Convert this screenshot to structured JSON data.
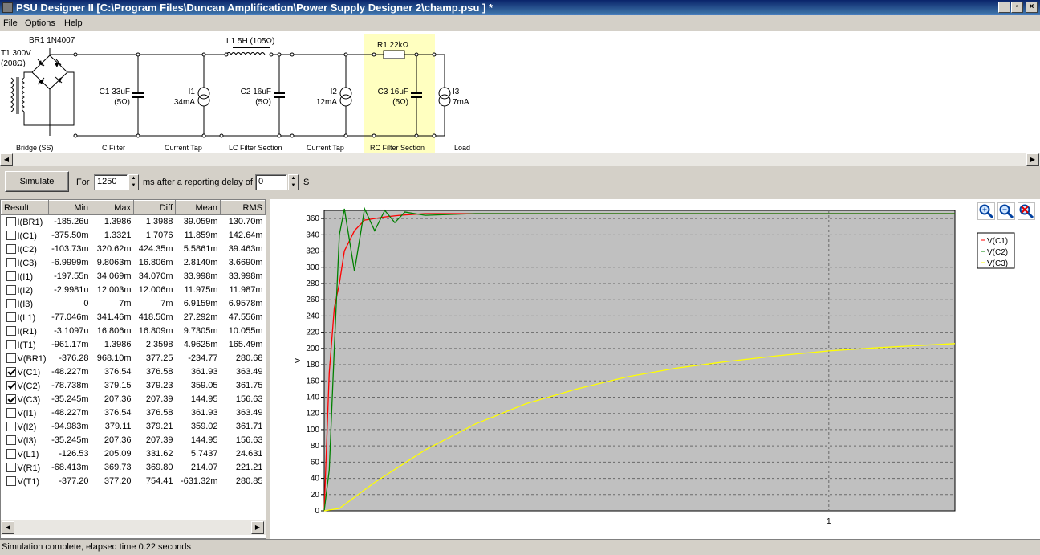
{
  "window": {
    "title": "PSU Designer II  [C:\\Program Files\\Duncan Amplification\\Power Supply Designer 2\\champ.psu ] *"
  },
  "menu": [
    "File",
    "Options",
    "Help"
  ],
  "schematic": {
    "transformer": {
      "name": "T1 300V",
      "detail": "(208Ω)"
    },
    "rectifier": "BR1 1N4007",
    "c1": {
      "name": "C1 33uF",
      "detail": "(5Ω)"
    },
    "i1": {
      "name": "I1",
      "detail": "34mA"
    },
    "l1": "L1 5H (105Ω)",
    "c2": {
      "name": "C2 16uF",
      "detail": "(5Ω)"
    },
    "i2": {
      "name": "I2",
      "detail": "12mA"
    },
    "r1": "R1 22kΩ",
    "c3": {
      "name": "C3 16uF",
      "detail": "(5Ω)"
    },
    "i3": {
      "name": "I3",
      "detail": "7mA"
    },
    "sections": [
      "Bridge (SS)",
      "C Filter",
      "Current Tap",
      "LC Filter Section",
      "Current Tap",
      "RC Filter Section",
      "Load"
    ]
  },
  "sim": {
    "button": "Simulate",
    "for_label": "For",
    "ms_value": "1250",
    "ms_label": "ms  after a reporting delay of",
    "delay_value": "0",
    "unit": "S"
  },
  "table": {
    "headers": [
      "Result",
      "Min",
      "Max",
      "Diff",
      "Mean",
      "RMS"
    ],
    "rows": [
      {
        "name": "I(BR1)",
        "checked": false,
        "v": [
          "-185.26u",
          "1.3986",
          "1.3988",
          "39.059m",
          "130.70m"
        ]
      },
      {
        "name": "I(C1)",
        "checked": false,
        "v": [
          "-375.50m",
          "1.3321",
          "1.7076",
          "11.859m",
          "142.64m"
        ]
      },
      {
        "name": "I(C2)",
        "checked": false,
        "v": [
          "-103.73m",
          "320.62m",
          "424.35m",
          "5.5861m",
          "39.463m"
        ]
      },
      {
        "name": "I(C3)",
        "checked": false,
        "v": [
          "-6.9999m",
          "9.8063m",
          "16.806m",
          "2.8140m",
          "3.6690m"
        ]
      },
      {
        "name": "I(I1)",
        "checked": false,
        "v": [
          "-197.55n",
          "34.069m",
          "34.070m",
          "33.998m",
          "33.998m"
        ]
      },
      {
        "name": "I(I2)",
        "checked": false,
        "v": [
          "-2.9981u",
          "12.003m",
          "12.006m",
          "11.975m",
          "11.987m"
        ]
      },
      {
        "name": "I(I3)",
        "checked": false,
        "v": [
          "0",
          "7m",
          "7m",
          "6.9159m",
          "6.9578m"
        ]
      },
      {
        "name": "I(L1)",
        "checked": false,
        "v": [
          "-77.046m",
          "341.46m",
          "418.50m",
          "27.292m",
          "47.556m"
        ]
      },
      {
        "name": "I(R1)",
        "checked": false,
        "v": [
          "-3.1097u",
          "16.806m",
          "16.809m",
          "9.7305m",
          "10.055m"
        ]
      },
      {
        "name": "I(T1)",
        "checked": false,
        "v": [
          "-961.17m",
          "1.3986",
          "2.3598",
          "4.9625m",
          "165.49m"
        ]
      },
      {
        "name": "V(BR1)",
        "checked": false,
        "v": [
          "-376.28",
          "968.10m",
          "377.25",
          "-234.77",
          "280.68"
        ]
      },
      {
        "name": "V(C1)",
        "checked": true,
        "v": [
          "-48.227m",
          "376.54",
          "376.58",
          "361.93",
          "363.49"
        ]
      },
      {
        "name": "V(C2)",
        "checked": true,
        "v": [
          "-78.738m",
          "379.15",
          "379.23",
          "359.05",
          "361.75"
        ]
      },
      {
        "name": "V(C3)",
        "checked": true,
        "v": [
          "-35.245m",
          "207.36",
          "207.39",
          "144.95",
          "156.63"
        ]
      },
      {
        "name": "V(I1)",
        "checked": false,
        "v": [
          "-48.227m",
          "376.54",
          "376.58",
          "361.93",
          "363.49"
        ]
      },
      {
        "name": "V(I2)",
        "checked": false,
        "v": [
          "-94.983m",
          "379.11",
          "379.21",
          "359.02",
          "361.71"
        ]
      },
      {
        "name": "V(I3)",
        "checked": false,
        "v": [
          "-35.245m",
          "207.36",
          "207.39",
          "144.95",
          "156.63"
        ]
      },
      {
        "name": "V(L1)",
        "checked": false,
        "v": [
          "-126.53",
          "205.09",
          "331.62",
          "5.7437",
          "24.631"
        ]
      },
      {
        "name": "V(R1)",
        "checked": false,
        "v": [
          "-68.413m",
          "369.73",
          "369.80",
          "214.07",
          "221.21"
        ]
      },
      {
        "name": "V(T1)",
        "checked": false,
        "v": [
          "-377.20",
          "377.20",
          "754.41",
          "-631.32m",
          "280.85"
        ]
      }
    ]
  },
  "chart_data": {
    "type": "line",
    "ylabel": "V",
    "xlabel": "",
    "xlim": [
      0,
      1.25
    ],
    "ylim": [
      0,
      370
    ],
    "yticks": [
      0,
      20,
      40,
      60,
      80,
      100,
      120,
      140,
      160,
      180,
      200,
      220,
      240,
      260,
      280,
      300,
      320,
      340,
      360
    ],
    "xticks": [
      1
    ],
    "grid": true,
    "legend_position": "top-right",
    "series": [
      {
        "name": "V(C1)",
        "color": "#ff0000",
        "x": [
          0,
          0.01,
          0.02,
          0.03,
          0.04,
          0.06,
          0.08,
          0.1,
          0.12,
          0.15,
          0.2,
          0.3,
          1.25
        ],
        "y": [
          0,
          170,
          250,
          280,
          320,
          345,
          358,
          360,
          362,
          364,
          366,
          366,
          366
        ]
      },
      {
        "name": "V(C2)",
        "color": "#008000",
        "x": [
          0,
          0.01,
          0.02,
          0.03,
          0.04,
          0.06,
          0.08,
          0.1,
          0.12,
          0.14,
          0.16,
          0.2,
          0.3,
          1.25
        ],
        "y": [
          0,
          50,
          200,
          340,
          372,
          295,
          372,
          345,
          370,
          355,
          368,
          364,
          366,
          366
        ]
      },
      {
        "name": "V(C3)",
        "color": "#ffff00",
        "x": [
          0,
          0.03,
          0.1,
          0.2,
          0.3,
          0.4,
          0.5,
          0.6,
          0.7,
          0.8,
          0.9,
          1.0,
          1.1,
          1.25
        ],
        "y": [
          0,
          3,
          35,
          75,
          107,
          132,
          150,
          165,
          176,
          184,
          191,
          197,
          201,
          206
        ]
      }
    ]
  },
  "status": "Simulation complete, elapsed time 0.22 seconds"
}
